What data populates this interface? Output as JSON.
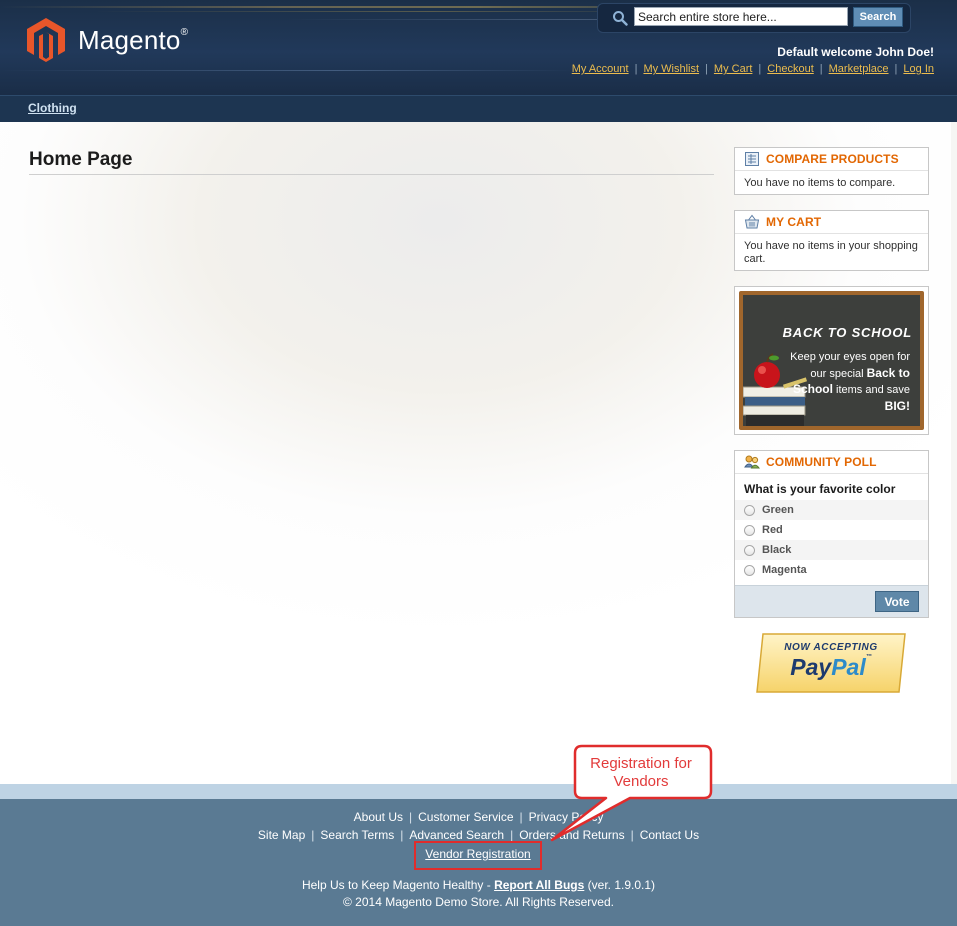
{
  "header": {
    "logo_text": "Magento",
    "logo_mark": "®",
    "search": {
      "placeholder": "Search entire store here...",
      "button_label": "Search"
    },
    "welcome": "Default welcome John Doe!",
    "links": [
      "My Account",
      "My Wishlist",
      "My Cart",
      "Checkout",
      "Marketplace",
      "Log In"
    ]
  },
  "nav": {
    "items": [
      "Clothing"
    ]
  },
  "main": {
    "page_title": "Home Page"
  },
  "sidebar": {
    "compare": {
      "title": "COMPARE PRODUCTS",
      "text": "You have no items to compare.",
      "icon": "compare-icon"
    },
    "cart": {
      "title": "MY CART",
      "text": "You have no items in your shopping cart.",
      "icon": "basket-icon"
    },
    "banner": {
      "title": "BACK TO SCHOOL",
      "line1": "Keep your eyes open for our special ",
      "bold1": "Back to School",
      "line2": " items and save ",
      "bold2": "BIG!"
    },
    "poll": {
      "title": "COMMUNITY POLL",
      "question": "What is your favorite color",
      "options": [
        "Green",
        "Red",
        "Black",
        "Magenta"
      ],
      "vote_label": "Vote",
      "icon": "poll-icon"
    },
    "paypal": {
      "line1": "NOW ACCEPTING",
      "pay": "Pay",
      "pal": "Pal",
      "tm": "™"
    }
  },
  "footer": {
    "row1": [
      "About Us",
      "Customer Service",
      "Privacy Policy"
    ],
    "row2": [
      "Site Map",
      "Search Terms",
      "Advanced Search",
      "Orders and Returns",
      "Contact Us"
    ],
    "vendor_link": "Vendor Registration",
    "help_prefix": "Help Us to Keep Magento Healthy - ",
    "help_link": "Report All Bugs",
    "help_suffix": " (ver. 1.9.0.1)",
    "copyright": "© 2014 Magento Demo Store. All Rights Reserved."
  },
  "annotation": {
    "callout": "Registration for Vendors"
  },
  "colors": {
    "header_bg": "#21395a",
    "link_accent": "#ebbc4e",
    "block_title": "#e26703",
    "footer_bg": "#5a7a93",
    "annotation_red": "#e02c2c"
  }
}
